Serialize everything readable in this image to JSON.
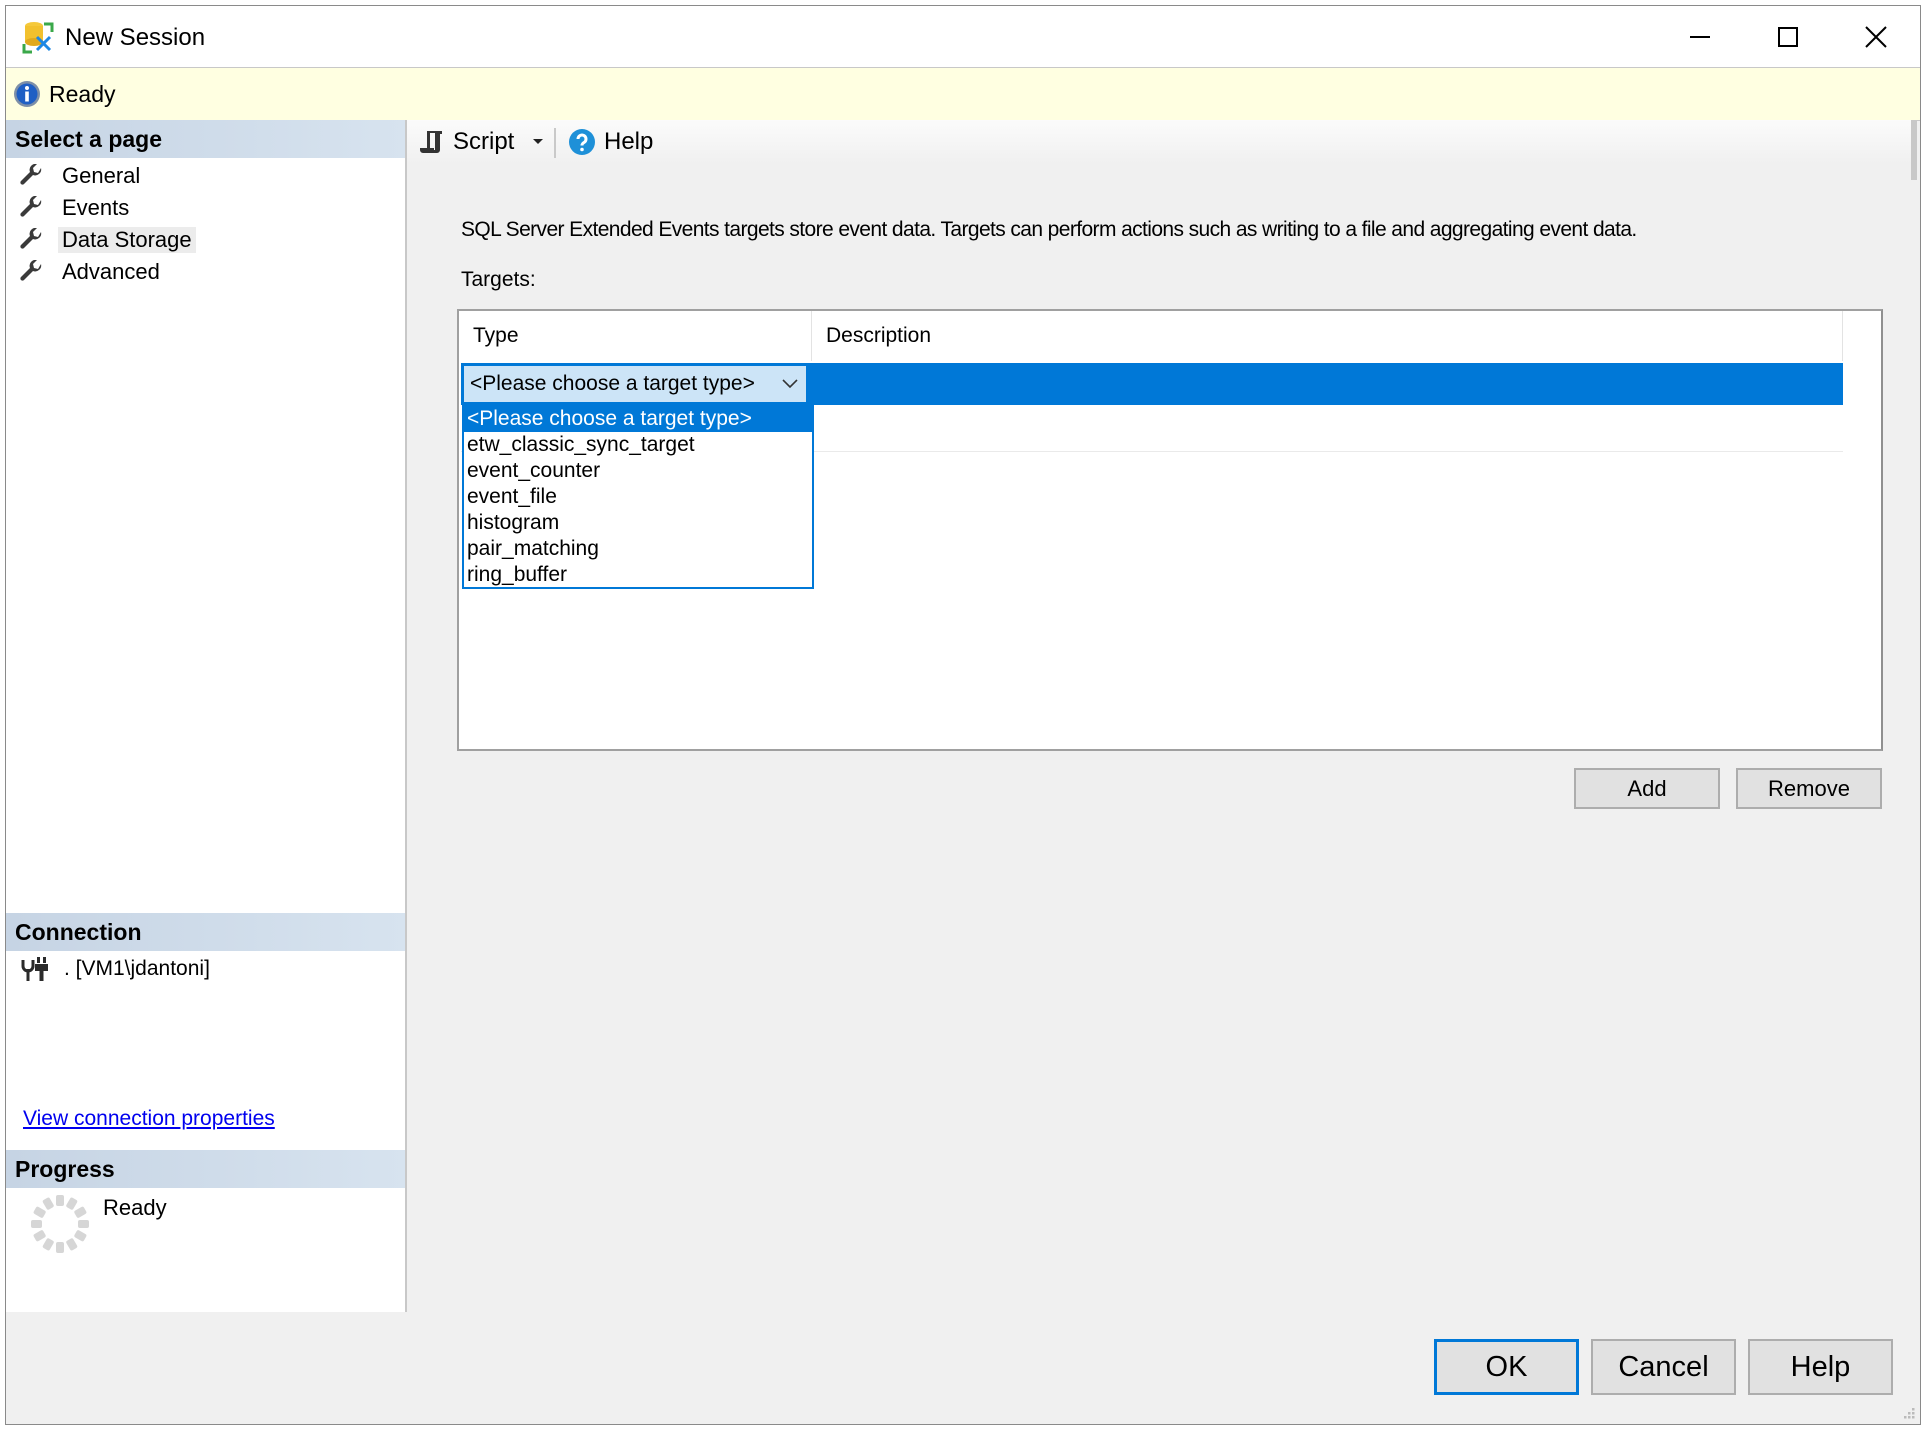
{
  "window": {
    "title": "New Session",
    "controls": {
      "minimize": "minimize-icon",
      "maximize": "maximize-icon",
      "close": "close-icon"
    }
  },
  "status_bar": {
    "icon": "info-icon",
    "text": "Ready"
  },
  "sidebar": {
    "select_page_header": "Select a page",
    "pages": [
      {
        "label": "General",
        "icon": "wrench-icon",
        "active": false
      },
      {
        "label": "Events",
        "icon": "wrench-icon",
        "active": false
      },
      {
        "label": "Data Storage",
        "icon": "wrench-icon",
        "active": true
      },
      {
        "label": "Advanced",
        "icon": "wrench-icon",
        "active": false
      }
    ],
    "connection_header": "Connection",
    "connection_value": ". [VM1\\jdantoni]",
    "view_connection_link": "View connection properties",
    "progress_header": "Progress",
    "progress_status": "Ready"
  },
  "toolbar": {
    "script_label": "Script",
    "help_label": "Help"
  },
  "content": {
    "description": "SQL Server Extended Events targets store event data. Targets can perform actions such as writing to a file and aggregating event data.",
    "targets_label": "Targets:",
    "grid": {
      "columns": [
        "Type",
        "Description"
      ],
      "rows": [
        {
          "type": "<Please choose a target type>",
          "description": "",
          "selected": true
        }
      ]
    },
    "type_dropdown": {
      "selected": "<Please choose a target type>",
      "options": [
        "<Please choose a target type>",
        "etw_classic_sync_target",
        "event_counter",
        "event_file",
        "histogram",
        "pair_matching",
        "ring_buffer"
      ]
    },
    "add_label": "Add",
    "remove_label": "Remove"
  },
  "footer": {
    "ok_label": "OK",
    "cancel_label": "Cancel",
    "help_label": "Help"
  },
  "colors": {
    "accent": "#0078d7",
    "info_bar": "#ffffe1",
    "section_header": "#c6d4e4",
    "link": "#0000ee"
  }
}
